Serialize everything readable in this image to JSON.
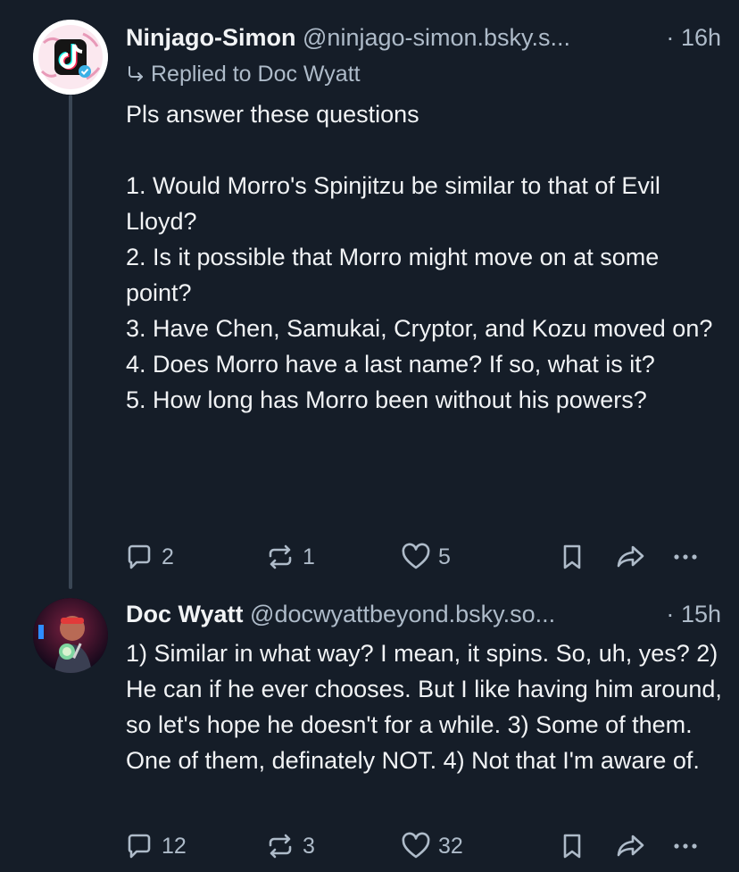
{
  "posts": [
    {
      "display_name": "Ninjago-Simon",
      "handle": "@ninjago-simon.bsky.s...",
      "separator": "·",
      "time": "16h",
      "reply_context": "Replied to Doc Wyatt",
      "body": "Pls answer these questions\n\n1. Would Morro's Spinjitzu be similar to that of Evil Lloyd?\n2. Is it possible that Morro might move on at some point?\n3. Have Chen, Samukai, Cryptor, and Kozu moved on?\n4. Does Morro have a last name? If so, what is it?\n5. How long has Morro been without his powers?",
      "replies": "2",
      "reposts": "1",
      "likes": "5",
      "avatar_icon": "tiktok-logo-avatar"
    },
    {
      "display_name": "Doc Wyatt",
      "handle": "@docwyattbeyond.bsky.so...",
      "separator": "·",
      "time": "15h",
      "body": "1) Similar in what way? I mean, it spins. So, uh, yes? 2) He can if he ever chooses. But I like having him around, so let's hope he doesn't for a while. 3) Some of them. One of them, definately NOT. 4) Not that I'm aware of.",
      "replies": "12",
      "reposts": "3",
      "likes": "32",
      "avatar_icon": "user-photo-avatar"
    }
  ],
  "icons": [
    "reply-icon",
    "repost-icon",
    "like-icon",
    "bookmark-icon",
    "share-icon",
    "more-icon"
  ],
  "colors": {
    "background": "#151d28",
    "text": "#f1f3f5",
    "muted": "#aebbc9",
    "thread_line": "#3a4654"
  }
}
